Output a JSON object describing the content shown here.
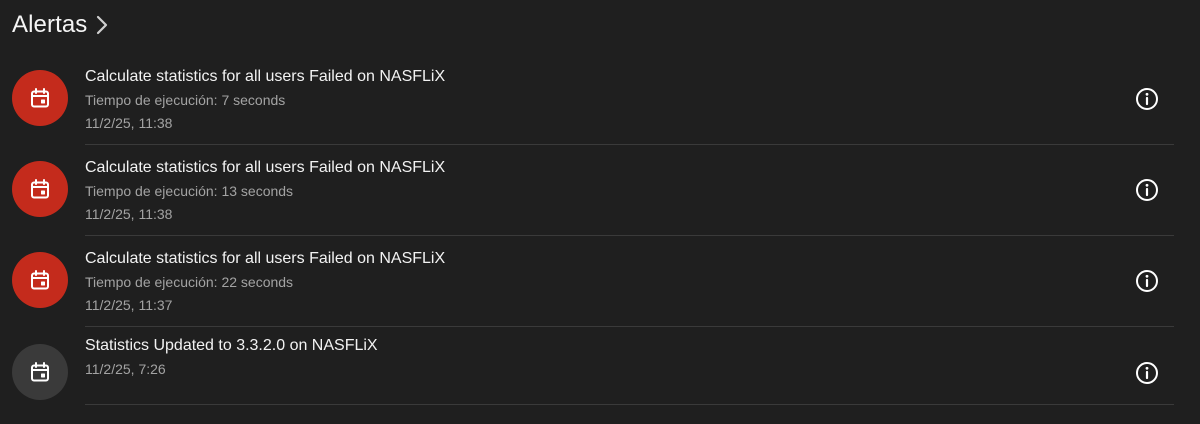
{
  "header": {
    "title": "Alertas",
    "chevron_icon": "chevron-right-icon"
  },
  "colors": {
    "background": "#1f1f1f",
    "error": "#c42b1c",
    "neutral": "#3a3a3a"
  },
  "alerts": [
    {
      "title": "Calculate statistics for all users Failed on NASFLiX",
      "detail": "Tiempo de ejecución: 7 seconds",
      "date": "11/2/25, 11:38",
      "status": "error",
      "icon": "calendar-icon"
    },
    {
      "title": "Calculate statistics for all users Failed on NASFLiX",
      "detail": "Tiempo de ejecución: 13 seconds",
      "date": "11/2/25, 11:38",
      "status": "error",
      "icon": "calendar-icon"
    },
    {
      "title": "Calculate statistics for all users Failed on NASFLiX",
      "detail": "Tiempo de ejecución: 22 seconds",
      "date": "11/2/25, 11:37",
      "status": "error",
      "icon": "calendar-icon"
    },
    {
      "title": "Statistics Updated to 3.3.2.0 on NASFLiX",
      "date": "11/2/25, 7:26",
      "status": "info",
      "icon": "calendar-icon"
    }
  ]
}
